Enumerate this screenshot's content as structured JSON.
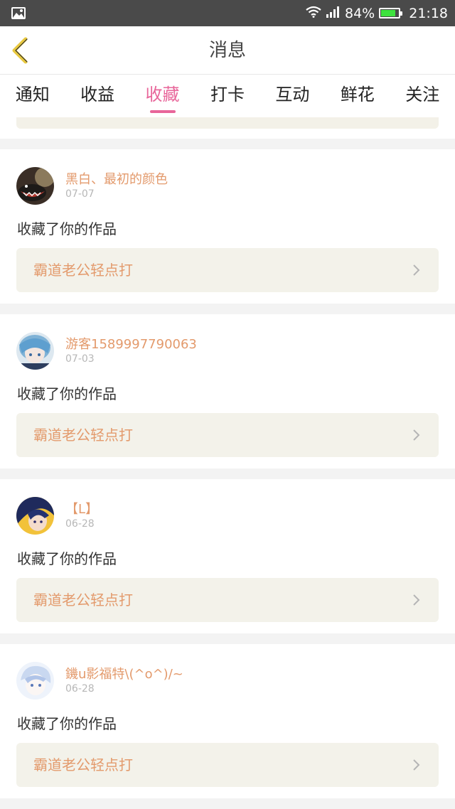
{
  "status_bar": {
    "battery_percent": "84%",
    "battery_level": 0.84,
    "time": "21:18",
    "icons": [
      "gallery-icon",
      "wifi-icon",
      "signal-icon",
      "battery-icon"
    ]
  },
  "header": {
    "title": "消息",
    "back_icon": "chevron-left-icon"
  },
  "tabs": [
    {
      "label": "通知",
      "active": false
    },
    {
      "label": "收益",
      "active": false
    },
    {
      "label": "收藏",
      "active": true
    },
    {
      "label": "打卡",
      "active": false
    },
    {
      "label": "互动",
      "active": false
    },
    {
      "label": "鲜花",
      "active": false
    },
    {
      "label": "关注",
      "active": false
    }
  ],
  "colors": {
    "accent_pink": "#e8669a",
    "name_orange": "#e39a6c",
    "card_bg": "#f3f2ea"
  },
  "feed": [
    {
      "user": "黑白、最初的颜色",
      "date": "07-07",
      "action": "收藏了你的作品",
      "work_title": "霸道老公轻点打"
    },
    {
      "user": "游客1589997790063",
      "date": "07-03",
      "action": "收藏了你的作品",
      "work_title": "霸道老公轻点打"
    },
    {
      "user": "【L】",
      "date": "06-28",
      "action": "收藏了你的作品",
      "work_title": "霸道老公轻点打"
    },
    {
      "user": "鐖u影福特\\(^o^)/~",
      "date": "06-28",
      "action": "收藏了你的作品",
      "work_title": "霸道老公轻点打"
    }
  ]
}
